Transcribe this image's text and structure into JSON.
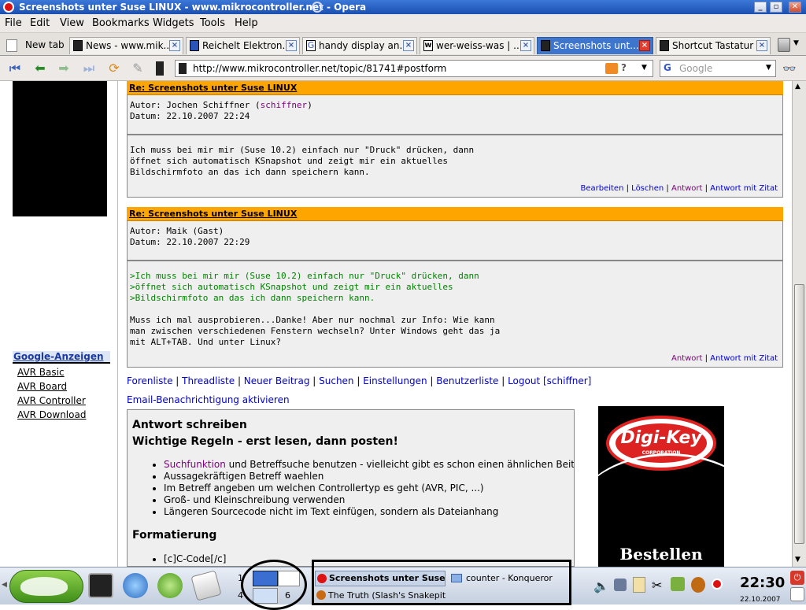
{
  "window": {
    "title": "Screenshots unter Suse LINUX - www.mikrocontroller.net - Opera"
  },
  "menu": [
    "File",
    "Edit",
    "View",
    "Bookmarks",
    "Widgets",
    "Tools",
    "Help"
  ],
  "tabs": {
    "new_tab": "New tab",
    "items": [
      {
        "label": "News - www.mik..."
      },
      {
        "label": "Reichelt Elektron..."
      },
      {
        "label": "handy display an..."
      },
      {
        "label": "wer-weiss-was | ..."
      },
      {
        "label": "Screenshots unt..."
      },
      {
        "label": "Shortcut Tastatur ..."
      }
    ]
  },
  "address": {
    "url": "http://www.mikrocontroller.net/topic/81741#postform"
  },
  "search": {
    "placeholder": "Google"
  },
  "sidebar": {
    "ads_title": "Google-Anzeigen",
    "links": [
      "AVR Basic",
      "AVR Board",
      "AVR Controller",
      "AVR Download"
    ]
  },
  "posts": [
    {
      "title": "Re: Screenshots unter Suse LINUX",
      "author_label": "Autor: Jochen Schiffner (",
      "author_user": "schiffner",
      "author_close": ")",
      "date": "Datum: 22.10.2007 22:24",
      "body": [
        "Ich muss bei mir mir (Suse 10.2) einfach nur \"Druck\" drücken, dann",
        "öffnet sich automatisch KSnapshot und zeigt mir ein aktuelles",
        "Bildschirmfoto an das ich dann speichern kann."
      ],
      "actions": [
        "Bearbeiten",
        "Löschen",
        "Antwort",
        "Antwort mit Zitat"
      ]
    },
    {
      "title": "Re: Screenshots unter Suse LINUX",
      "author_label": "Autor: Maik (Gast)",
      "date": "Datum: 22.10.2007 22:29",
      "quote": [
        ">Ich muss bei mir mir (Suse 10.2) einfach nur \"Druck\" drücken, dann",
        ">öffnet sich automatisch KSnapshot und zeigt mir ein aktuelles",
        ">Bildschirmfoto an das ich dann speichern kann."
      ],
      "body": [
        "Muss ich mal ausprobieren...Danke! Aber nur nochmal zur Info: Wie kann",
        "man zwischen verschiedenen Fenstern wechseln? Unter Windows geht das ja",
        "mit ALT+TAB. Und unter Linux?"
      ],
      "actions": [
        "Antwort",
        "Antwort mit Zitat"
      ]
    }
  ],
  "forum_nav": [
    "Forenliste",
    "Threadliste",
    "Neuer Beitrag",
    "Suchen",
    "Einstellungen",
    "Benutzerliste",
    "Logout [schiffner]"
  ],
  "email_notify": "Email-Benachrichtigung aktivieren",
  "reply": {
    "heading": "Antwort schreiben",
    "rules_heading": "Wichtige Regeln - erst lesen, dann posten!",
    "rules": [
      {
        "link": "Suchfunktion",
        "text": " und Betreffsuche benutzen - vielleicht gibt es schon einen ähnlichen Beitrag"
      },
      {
        "text": "Aussagekräftigen Betreff waehlen"
      },
      {
        "text": "Im Betreff angeben um welchen Controllertyp es geht (AVR, PIC, ...)"
      },
      {
        "text": "Groß- und Kleinschreibung verwenden"
      },
      {
        "text": "Längeren Sourcecode nicht im Text einfügen, sondern als Dateianhang"
      }
    ],
    "format_heading": "Formatierung",
    "format_items": [
      "[c]C-Code[/c]"
    ]
  },
  "ad": {
    "brand": "Digi-Key",
    "sub": "CORPORATION",
    "cta": "Bestellen"
  },
  "taskbar": {
    "desktops": [
      "1",
      "4",
      "6"
    ],
    "tasks": [
      {
        "label": "Screenshots unter Suse Li"
      },
      {
        "label": "counter - Konqueror"
      },
      {
        "label": "The Truth (Slash's Snakepit) - "
      }
    ],
    "clock": "22:30",
    "date": "22.10.2007"
  }
}
